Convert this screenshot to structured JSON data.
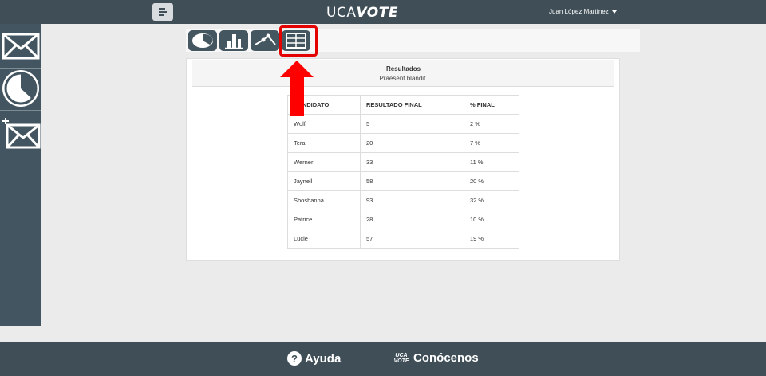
{
  "header": {
    "logo_left": "UCA",
    "logo_right": "VOTE",
    "user_name": "Juan López Martínez"
  },
  "sidebar": {
    "items": [
      {
        "icon": "envelope-icon"
      },
      {
        "icon": "pie-chart-icon"
      },
      {
        "icon": "new-envelope-icon"
      }
    ]
  },
  "toolbar": {
    "buttons": [
      {
        "icon": "pie-chart-icon"
      },
      {
        "icon": "bar-chart-icon"
      },
      {
        "icon": "line-chart-icon"
      },
      {
        "icon": "table-icon",
        "selected": true
      }
    ]
  },
  "panel": {
    "title": "Resultados",
    "subtitle": "Praesent blandit."
  },
  "table": {
    "headers": [
      "CANDIDATO",
      "RESULTADO FINAL",
      "% FINAL"
    ],
    "rows": [
      [
        "Wolf",
        "5",
        "2 %"
      ],
      [
        "Tera",
        "20",
        "7 %"
      ],
      [
        "Werner",
        "33",
        "11 %"
      ],
      [
        "Jaynell",
        "58",
        "20 %"
      ],
      [
        "Shoshanna",
        "93",
        "32 %"
      ],
      [
        "Patrice",
        "28",
        "10 %"
      ],
      [
        "Lucie",
        "57",
        "19 %"
      ]
    ]
  },
  "footer": {
    "help_label": "Ayuda",
    "about_label": "Conócenos",
    "mini_logo_top": "UCA",
    "mini_logo_bottom": "VOTE"
  },
  "colors": {
    "header_bg": "#3f4e57",
    "sidebar_bg": "#435560",
    "toolbar_btn": "#445761",
    "highlight": "#e50000",
    "arrow": "#ff0000"
  }
}
